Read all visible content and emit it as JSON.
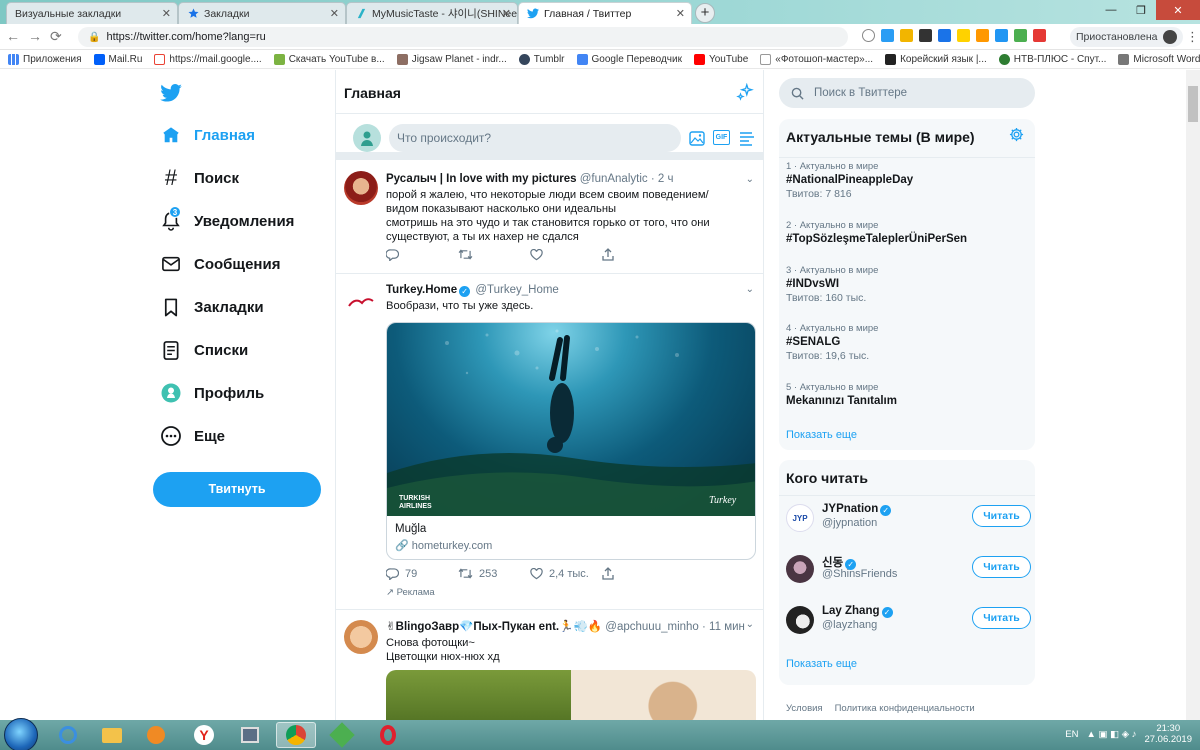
{
  "browser": {
    "tabs": [
      {
        "title": "Визуальные закладки",
        "active": false
      },
      {
        "title": "Закладки",
        "active": false
      },
      {
        "title": "MyMusicTaste - 샤이니(SHINee)",
        "active": false
      },
      {
        "title": "Главная / Твиттер",
        "active": true
      }
    ],
    "new_tab": "+",
    "url": "https://twitter.com/home?lang=ru",
    "profile_status": "Приостановлена",
    "bookmarks": [
      "Приложения",
      "Mail.Ru",
      "https://mail.google....",
      "Скачать YouTube в...",
      "Jigsaw Planet - indr...",
      "Tumblr",
      "Google Переводчик",
      "YouTube",
      "«Фотошоп-мастер»...",
      "Корейский язык |...",
      "НТВ-ПЛЮС - Спут...",
      "Microsoft Word - St..."
    ]
  },
  "sidebar": {
    "items": [
      {
        "label": "Главная",
        "icon": "home-icon",
        "active": true
      },
      {
        "label": "Поиск",
        "icon": "hashtag-icon"
      },
      {
        "label": "Уведомления",
        "icon": "bell-icon",
        "badge": "3"
      },
      {
        "label": "Сообщения",
        "icon": "envelope-icon"
      },
      {
        "label": "Закладки",
        "icon": "bookmark-icon"
      },
      {
        "label": "Списки",
        "icon": "list-icon"
      },
      {
        "label": "Профиль",
        "icon": "profile-icon"
      },
      {
        "label": "Еще",
        "icon": "more-icon"
      }
    ],
    "tweet_button": "Твитнуть"
  },
  "main": {
    "title": "Главная",
    "composer_placeholder": "Что происходит?",
    "composer_gif": "GIF",
    "tweets": [
      {
        "name": "Русалыч | In love with my pictures",
        "handle": "@funAnalytic",
        "time": "· 2 ч",
        "text": "порой я жалею, что некоторые люди всем своим поведением/видом показывают насколько они идеальны\nсмотришь на это чудо и так становится горько от того, что они существуют, а ты их нахер не сдался"
      },
      {
        "name": "Turkey.Home",
        "handle": "@Turkey_Home",
        "text": "Вообрази, что ты уже здесь.",
        "card": {
          "image_brand": "TURKISH AIRLINES",
          "image_logo": "Turkey",
          "title": "Muğla",
          "url": "hometurkey.com"
        },
        "replies": "79",
        "retweets": "253",
        "likes": "2,4 тыс.",
        "promoted": "Реклама"
      },
      {
        "name": "✌BlingoЗавр💎Пых-Пукан ent.🏃💨🔥",
        "handle": "@apchuuu_minho",
        "time": "· 11 мин",
        "text": "Снова фотощки~\nЦветощки нюх-нюх хд"
      }
    ]
  },
  "right": {
    "search_placeholder": "Поиск в Твиттере",
    "trends_title": "Актуальные темы (В мире)",
    "trends": [
      {
        "meta": "1 · Актуально в мире",
        "name": "#NationalPineappleDay",
        "count": "Твитов: 7 816"
      },
      {
        "meta": "2 · Актуально в мире",
        "name": "#TopSözleşmeTaleplerÜniPerSen",
        "count": ""
      },
      {
        "meta": "3 · Актуально в мире",
        "name": "#INDvsWI",
        "count": "Твитов: 160 тыс."
      },
      {
        "meta": "4 · Актуально в мире",
        "name": "#SENALG",
        "count": "Твитов: 19,6 тыс."
      },
      {
        "meta": "5 · Актуально в мире",
        "name": "Mekanınızı Tanıtalım",
        "count": ""
      }
    ],
    "show_more": "Показать еще",
    "who_title": "Кого читать",
    "who": [
      {
        "name": "JYPnation",
        "handle": "@jypnation",
        "button": "Читать"
      },
      {
        "name": "신동",
        "handle": "@ShinsFriends",
        "button": "Читать"
      },
      {
        "name": "Lay Zhang",
        "handle": "@layzhang",
        "button": "Читать"
      }
    ],
    "who_show_more": "Показать еще",
    "footer": [
      "Условия",
      "Политика конфиденциальности"
    ]
  },
  "taskbar": {
    "lang": "EN",
    "time": "21:30",
    "date": "27.06.2019"
  },
  "colors": {
    "accent": "#1da1f2",
    "text": "#14171a",
    "muted": "#657786",
    "border": "#e6ecf0"
  }
}
